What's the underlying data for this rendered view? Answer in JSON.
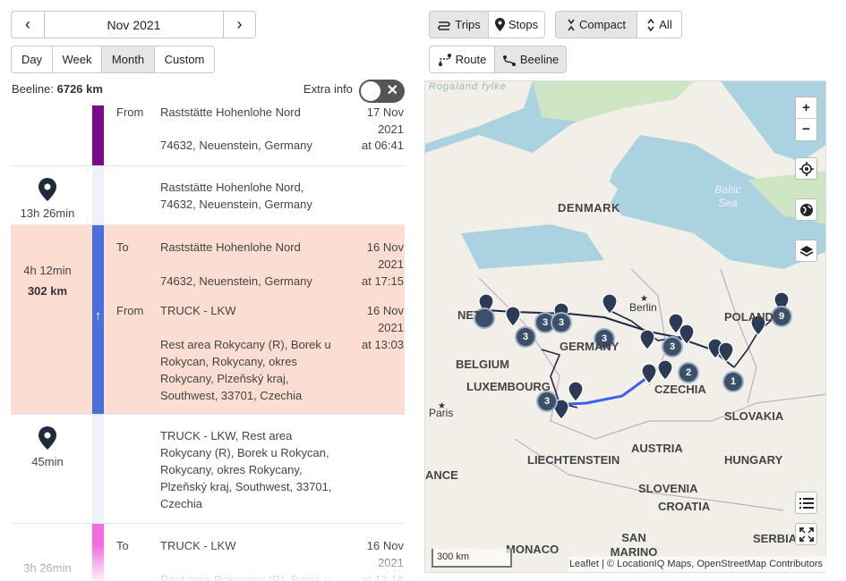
{
  "nav": {
    "prev_icon": "‹",
    "month": "Nov 2021",
    "next_icon": "›"
  },
  "range_tabs": [
    "Day",
    "Week",
    "Month",
    "Custom"
  ],
  "active_range": "Month",
  "view_toggles": {
    "trips": "Trips",
    "stops": "Stops",
    "compact": "Compact",
    "all": "All",
    "route": "Route",
    "beeline": "Beeline"
  },
  "summary": {
    "beeline_label": "Beeline:",
    "beeline_value": "6726 km",
    "extra_info": "Extra info"
  },
  "timeline": {
    "row1": {
      "label": "From",
      "place": "Raststätte Hohenlohe Nord",
      "address": "74632, Neuenstein, Germany",
      "date": "17 Nov 2021",
      "time": "at 06:41"
    },
    "stop1": {
      "duration": "13h 26min",
      "place": "Raststätte Hohenlohe Nord, 74632, Neuenstein, Germany"
    },
    "trip1": {
      "duration": "4h 12min",
      "distance": "302 km",
      "to_label": "To",
      "to_place": "Raststätte Hohenlohe Nord",
      "to_address": "74632, Neuenstein, Germany",
      "to_date": "16 Nov 2021",
      "to_time": "at 17:15",
      "from_label": "From",
      "from_place": "TRUCK - LKW",
      "from_address": "Rest area Rokycany (R), Borek u Rokycan, Rokycany, okres Rokycany, Plzeňský kraj, Southwest, 33701, Czechia",
      "from_date": "16 Nov 2021",
      "from_time": "at 13:03"
    },
    "stop2": {
      "duration": "45min",
      "place": "TRUCK - LKW, Rest area Rokycany (R), Borek u Rokycan, Rokycany, okres Rokycany, Plzeňský kraj, Southwest, 33701, Czechia"
    },
    "trip2": {
      "duration": "3h 26min",
      "to_label": "To",
      "to_place": "TRUCK - LKW",
      "to_address": "Rest area Rokycany (R), Borek u",
      "to_date": "16 Nov 2021",
      "to_time": "at 13:18"
    }
  },
  "colors": {
    "purple": "#7a0a8c",
    "blue": "#4a6fdc",
    "pink": "#f36de0",
    "trip_bg": "#fbddd2",
    "track": "#eef2f8",
    "marker": "#2b3a55",
    "cluster": "#3c5069",
    "route": "#3a62e8"
  },
  "map": {
    "labels": {
      "denmark": "DENMARK",
      "netherlands": "NETHERLANDS",
      "belgium": "BELGIUM",
      "luxembourg": "LUXEMBOURG",
      "germany": "GERMANY",
      "poland": "POLAND",
      "czechia": "CZECHIA",
      "slovakia": "SLOVAKIA",
      "austria": "AUSTRIA",
      "hungary": "HUNGARY",
      "liechtenstein": "LIECHTENSTEIN",
      "slovenia": "SLOVENIA",
      "croatia": "CROATIA",
      "san_marino": "SAN MARINO",
      "monaco": "MONACO",
      "serbia": "SERBIA",
      "france": "ANCE",
      "berlin": "Berlin",
      "paris": "Paris",
      "baltic": "Baltic Sea",
      "rogaland": "Rogaland fylke"
    },
    "clusters": [
      "3",
      "3",
      "3",
      "3",
      "2",
      "3",
      "9",
      "1",
      "3"
    ],
    "zoom_in": "+",
    "zoom_out": "−",
    "scale": "300 km",
    "attribution": "Leaflet | © LocationIQ Maps, OpenStreetMap Contributors",
    "icons": [
      "locate-icon",
      "globe-icon",
      "layers-icon",
      "list-icon",
      "fullscreen-icon"
    ]
  }
}
